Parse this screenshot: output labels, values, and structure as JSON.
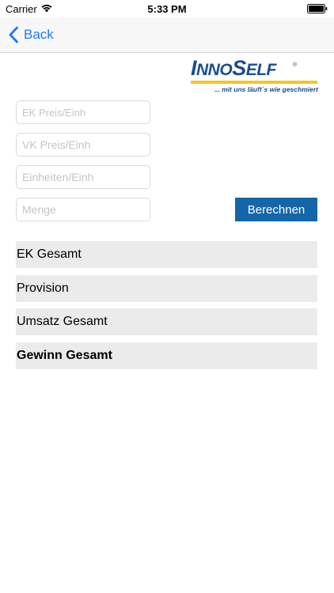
{
  "status_bar": {
    "carrier": "Carrier",
    "time": "5:33 PM"
  },
  "nav": {
    "back_label": "Back",
    "accent_color": "#1a7cf5"
  },
  "logo": {
    "brand_part1": "I",
    "brand_part2": "NNO",
    "brand_part3": "S",
    "brand_part4": "ELF",
    "registered": "®",
    "tagline": "... mit uns läuft´s wie geschmiert",
    "brand_color": "#1a4d92",
    "stripe_color": "#f3c623"
  },
  "form": {
    "ek_placeholder": "EK Preis/Einh",
    "vk_placeholder": "VK Preis/Einh",
    "einheiten_placeholder": "Einheiten/Einh",
    "menge_placeholder": "Menge",
    "calculate_label": "Berechnen",
    "button_color": "#1466a8"
  },
  "results": {
    "ek_gesamt": "EK Gesamt",
    "provision": "Provision",
    "umsatz_gesamt": "Umsatz Gesamt",
    "gewinn_gesamt": "Gewinn Gesamt"
  }
}
